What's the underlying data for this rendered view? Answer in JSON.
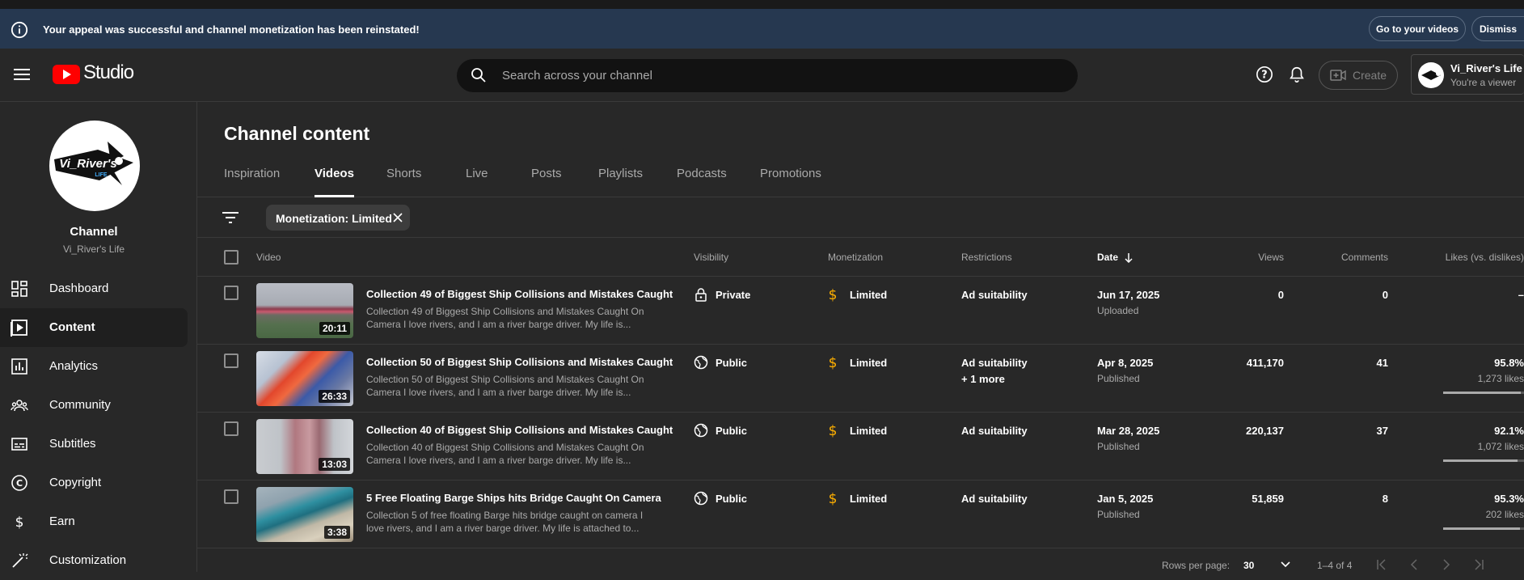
{
  "banner": {
    "message": "Your appeal was successful and channel monetization has been reinstated!",
    "go_label": "Go to your videos",
    "dismiss_label": "Dismiss"
  },
  "header": {
    "logo_text": "Studio",
    "search_placeholder": "Search across your channel",
    "create_label": "Create",
    "account_name": "Vi_River's Life",
    "account_role": "You're a viewer"
  },
  "channel": {
    "title": "Channel",
    "name": "Vi_River's Life",
    "logo_text": "Vi_River's",
    "logo_sub": "LIFE"
  },
  "sidebar": {
    "items": [
      {
        "label": "Dashboard",
        "icon": "dashboard-icon"
      },
      {
        "label": "Content",
        "icon": "content-icon",
        "active": true
      },
      {
        "label": "Analytics",
        "icon": "analytics-icon"
      },
      {
        "label": "Community",
        "icon": "community-icon"
      },
      {
        "label": "Subtitles",
        "icon": "subtitles-icon"
      },
      {
        "label": "Copyright",
        "icon": "copyright-icon"
      },
      {
        "label": "Earn",
        "icon": "earn-icon"
      },
      {
        "label": "Customization",
        "icon": "customization-icon"
      }
    ]
  },
  "main": {
    "title": "Channel content",
    "tabs": [
      "Inspiration",
      "Videos",
      "Shorts",
      "Live",
      "Posts",
      "Playlists",
      "Podcasts",
      "Promotions"
    ],
    "active_tab": "Videos",
    "filter_chip": "Monetization: Limited"
  },
  "table": {
    "headers": {
      "video": "Video",
      "visibility": "Visibility",
      "monetization": "Monetization",
      "restrictions": "Restrictions",
      "date": "Date",
      "views": "Views",
      "comments": "Comments",
      "likes": "Likes (vs. dislikes)"
    },
    "rows": [
      {
        "title": "Collection 49 of Biggest Ship Collisions and Mistakes Caught ...",
        "description": "Collection 49 of Biggest Ship Collisions and Mistakes Caught On Camera I love rivers, and I am a river barge driver. My life is...",
        "duration": "20:11",
        "visibility": "Private",
        "monetization": "Limited",
        "restrictions": "Ad suitability",
        "restrictions_more": "",
        "date": "Jun 17, 2025",
        "status": "Uploaded",
        "views": "0",
        "comments": "0",
        "likes_pct": "–",
        "likes_count": "",
        "likes_fraction": 0
      },
      {
        "title": "Collection 50 of Biggest Ship Collisions and Mistakes Caught ...",
        "description": "Collection 50 of Biggest Ship Collisions and Mistakes Caught On Camera I love rivers, and I am a river barge driver. My life is...",
        "duration": "26:33",
        "visibility": "Public",
        "monetization": "Limited",
        "restrictions": "Ad suitability",
        "restrictions_more": "+ 1 more",
        "date": "Apr 8, 2025",
        "status": "Published",
        "views": "411,170",
        "comments": "41",
        "likes_pct": "95.8%",
        "likes_count": "1,273 likes",
        "likes_fraction": 0.958
      },
      {
        "title": "Collection 40 of Biggest Ship Collisions and Mistakes Caught ...",
        "description": "Collection 40 of Biggest Ship Collisions and Mistakes Caught On Camera I love rivers, and I am a river barge driver. My life is...",
        "duration": "13:03",
        "visibility": "Public",
        "monetization": "Limited",
        "restrictions": "Ad suitability",
        "restrictions_more": "",
        "date": "Mar 28, 2025",
        "status": "Published",
        "views": "220,137",
        "comments": "37",
        "likes_pct": "92.1%",
        "likes_count": "1,072 likes",
        "likes_fraction": 0.921
      },
      {
        "title": "5 Free Floating Barge Ships hits Bridge Caught On Camera",
        "description": "Collection 5 of free floating Barge hits bridge caught on camera I love rivers, and I am a river barge driver. My life is attached to...",
        "duration": "3:38",
        "visibility": "Public",
        "monetization": "Limited",
        "restrictions": "Ad suitability",
        "restrictions_more": "",
        "date": "Jan 5, 2025",
        "status": "Published",
        "views": "51,859",
        "comments": "8",
        "likes_pct": "95.3%",
        "likes_count": "202 likes",
        "likes_fraction": 0.953
      }
    ]
  },
  "pagination": {
    "rows_label": "Rows per page:",
    "rows_value": "30",
    "range": "1–4 of 4"
  },
  "colors": {
    "accent_dollar": "#ffb000",
    "banner_bg": "#263850",
    "youtube_red": "#ff0000"
  }
}
